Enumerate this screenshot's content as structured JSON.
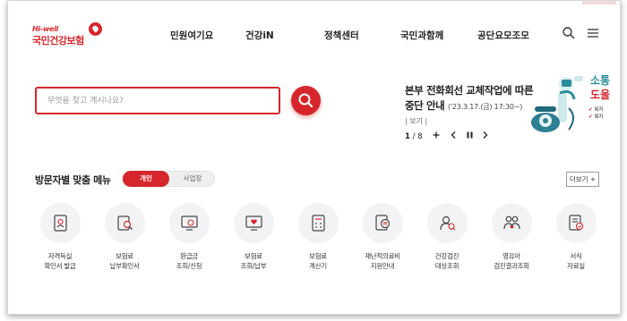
{
  "logo": {
    "english": "Hi-well",
    "korean": "국민건강보험"
  },
  "gnb": [
    {
      "label": "민원여기요"
    },
    {
      "label": "건강iN"
    },
    {
      "label": "정책센터"
    },
    {
      "label": "국민과함께"
    },
    {
      "label": "공단요모조모"
    }
  ],
  "header_icons": {
    "search": "search-icon",
    "menu": "hamburger-menu-icon"
  },
  "search": {
    "placeholder": "무엇을 찾고 계시나요?",
    "value": "",
    "button_icon": "search-icon"
  },
  "notice": {
    "title_line1": "본부 전화회선 교체작업에 따른",
    "title_line2": "중단 안내",
    "date": "('23.3.17.(금) 17:30~)",
    "more": "| 보기 |",
    "pager": {
      "current": "1",
      "separator": "/",
      "total": "8"
    }
  },
  "banner": {
    "headline_top": "소통",
    "headline_bottom": "도울",
    "check1": "복지",
    "check2": "복지"
  },
  "visitor_menu": {
    "title": "방문자별 맞춤 메뉴",
    "tabs": {
      "active": "개인",
      "inactive": "사업장"
    },
    "more": "더보기 +",
    "items": [
      {
        "label": "자격득실\n확인서 발급",
        "icon": "certificate-icon"
      },
      {
        "label": "보험료\n납부확인서",
        "icon": "search-document-icon"
      },
      {
        "label": "환급금\n조회/신청",
        "icon": "refund-monitor-icon"
      },
      {
        "label": "보험료\n조회/납부",
        "icon": "payment-monitor-icon"
      },
      {
        "label": "보험료\n계산기",
        "icon": "calculator-icon"
      },
      {
        "label": "재난적의료비\n지원안내",
        "icon": "medical-support-icon"
      },
      {
        "label": "건강검진\n대상조회",
        "icon": "health-checkup-icon"
      },
      {
        "label": "영유아\n검진결과조회",
        "icon": "infant-checkup-icon"
      },
      {
        "label": "서식\n자료실",
        "icon": "forms-library-icon"
      }
    ]
  },
  "colors": {
    "brand": "#d6262b",
    "text": "#222222",
    "icon_bg": "#f3f3f5",
    "banner_teal": "#2a8c9c"
  }
}
